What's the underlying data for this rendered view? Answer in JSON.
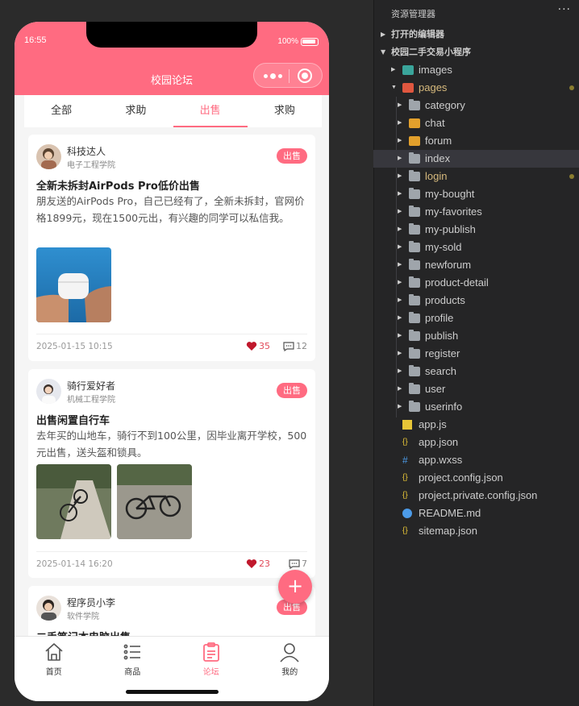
{
  "status": {
    "time": "16:55",
    "battery": "100%"
  },
  "navbar": {
    "title": "校园论坛"
  },
  "tabs": [
    {
      "label": "全部",
      "active": false
    },
    {
      "label": "求助",
      "active": false
    },
    {
      "label": "出售",
      "active": true
    },
    {
      "label": "求购",
      "active": false
    }
  ],
  "posts": [
    {
      "user": "科技达人",
      "school": "电子工程学院",
      "badge": "出售",
      "title": "全新未拆封AirPods Pro低价出售",
      "content": "朋友送的AirPods Pro，自己已经有了，全新未拆封，官网价格1899元，现在1500元出，有兴趣的同学可以私信我。",
      "date": "2025-01-15 10:15",
      "likes": "35",
      "comments": "12"
    },
    {
      "user": "骑行爱好者",
      "school": "机械工程学院",
      "badge": "出售",
      "title": "出售闲置自行车",
      "content": "去年买的山地车，骑行不到100公里，因毕业离开学校，500元出售，送头盔和锁具。",
      "date": "2025-01-14 16:20",
      "likes": "23",
      "comments": "7"
    },
    {
      "user": "程序员小李",
      "school": "软件学院",
      "badge": "出售",
      "title": "二手笔记本电脑出售"
    }
  ],
  "fab": {
    "label": "+"
  },
  "tabbar": [
    {
      "label": "首页",
      "icon": "home-icon",
      "active": false
    },
    {
      "label": "商品",
      "icon": "list-icon",
      "active": false
    },
    {
      "label": "论坛",
      "icon": "clipboard-icon",
      "active": true
    },
    {
      "label": "我的",
      "icon": "user-icon",
      "active": false
    }
  ],
  "explorer": {
    "title": "资源管理器",
    "more": "···",
    "sections": {
      "open_editors": "打开的编辑器",
      "project": "校园二手交易小程序"
    },
    "tree": [
      {
        "label": "images",
        "type": "folder-special"
      },
      {
        "label": "pages",
        "type": "folder-special"
      },
      {
        "label": "category",
        "type": "folder"
      },
      {
        "label": "chat",
        "type": "folder-special"
      },
      {
        "label": "forum",
        "type": "folder-special"
      },
      {
        "label": "index",
        "type": "folder"
      },
      {
        "label": "login",
        "type": "folder"
      },
      {
        "label": "my-bought",
        "type": "folder"
      },
      {
        "label": "my-favorites",
        "type": "folder"
      },
      {
        "label": "my-publish",
        "type": "folder"
      },
      {
        "label": "my-sold",
        "type": "folder"
      },
      {
        "label": "newforum",
        "type": "folder"
      },
      {
        "label": "product-detail",
        "type": "folder"
      },
      {
        "label": "products",
        "type": "folder"
      },
      {
        "label": "profile",
        "type": "folder"
      },
      {
        "label": "publish",
        "type": "folder"
      },
      {
        "label": "register",
        "type": "folder"
      },
      {
        "label": "search",
        "type": "folder"
      },
      {
        "label": "user",
        "type": "folder"
      },
      {
        "label": "userinfo",
        "type": "folder"
      },
      {
        "label": "app.js",
        "type": "js-file"
      },
      {
        "label": "app.json",
        "type": "json-file"
      },
      {
        "label": "app.wxss",
        "type": "css-file"
      },
      {
        "label": "project.config.json",
        "type": "json-file"
      },
      {
        "label": "project.private.config.json",
        "type": "json-file"
      },
      {
        "label": "README.md",
        "type": "info-file"
      },
      {
        "label": "sitemap.json",
        "type": "json-file"
      }
    ],
    "colors": {
      "modified": "#d7ba7d",
      "selected_bg": "#37373d"
    }
  },
  "colors": {
    "accent": "#ff6b81"
  }
}
